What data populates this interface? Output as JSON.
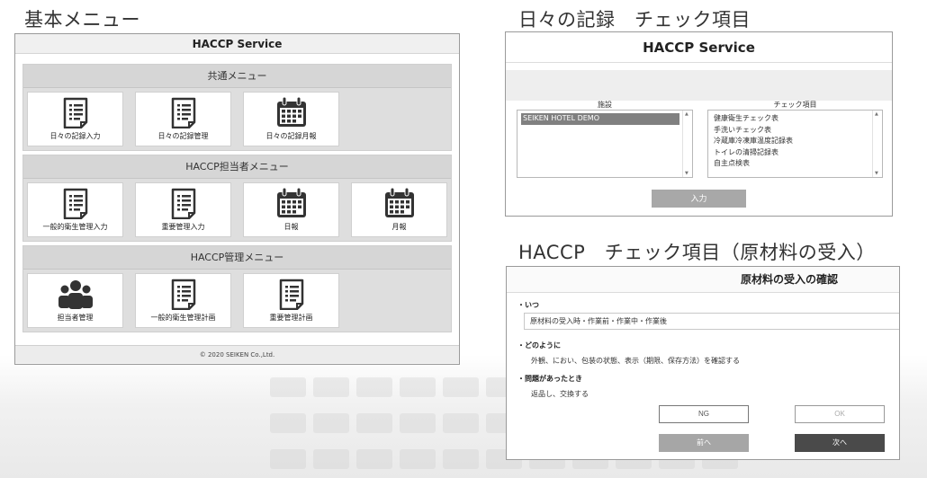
{
  "titles": {
    "basic_menu": "基本メニュー",
    "daily_check": "日々の記録　チェック項目",
    "haccp_check": "HACCP　チェック項目（原材料の受入）"
  },
  "panel1": {
    "app_title": "HACCP Service",
    "groups": [
      {
        "title": "共通メニュー",
        "tiles": [
          {
            "label": "日々の記録入力",
            "icon": "document-icon"
          },
          {
            "label": "日々の記録管理",
            "icon": "document-icon"
          },
          {
            "label": "日々の記録月報",
            "icon": "calendar-icon"
          }
        ]
      },
      {
        "title": "HACCP担当者メニュー",
        "tiles": [
          {
            "label": "一般的衛生管理入力",
            "icon": "document-icon"
          },
          {
            "label": "重要管理入力",
            "icon": "document-icon"
          },
          {
            "label": "日報",
            "icon": "calendar-icon"
          },
          {
            "label": "月報",
            "icon": "calendar-icon"
          }
        ]
      },
      {
        "title": "HACCP管理メニュー",
        "tiles": [
          {
            "label": "担当者管理",
            "icon": "users-icon"
          },
          {
            "label": "一般的衛生管理計画",
            "icon": "document-icon"
          },
          {
            "label": "重要管理計画",
            "icon": "document-icon"
          }
        ]
      }
    ],
    "footer": "© 2020 SEIKEN Co.,Ltd."
  },
  "panel2": {
    "app_title": "HACCP Service",
    "facility_label": "施設",
    "facilities": [
      "SEIKEN HOTEL DEMO"
    ],
    "check_label": "チェック項目",
    "check_items": [
      "健康衛生チェック表",
      "手洗いチェック表",
      "冷蔵庫冷凍庫温度記録表",
      "トイレの清掃記録表",
      "自主点検表"
    ],
    "enter_button": "入力"
  },
  "panel3": {
    "title": "原材料の受入の確認",
    "when_label": "・いつ",
    "when_value": "原材料の受入時・作業前・作業中・作業後",
    "how_label": "・どのように",
    "how_text": "外観、におい、包装の状態、表示（期限、保存方法）を確認する",
    "problem_label": "・問題があったとき",
    "problem_text": "返品し、交換する",
    "ng_button": "NG",
    "ok_button": "OK",
    "prev_button": "前へ",
    "next_button": "次へ"
  },
  "colors": {
    "prev_button_bg": "#a6a6a6",
    "next_button_bg": "#4a4a4a",
    "enter_button_bg": "#a8a8a8",
    "icon_dark": "#333333"
  }
}
